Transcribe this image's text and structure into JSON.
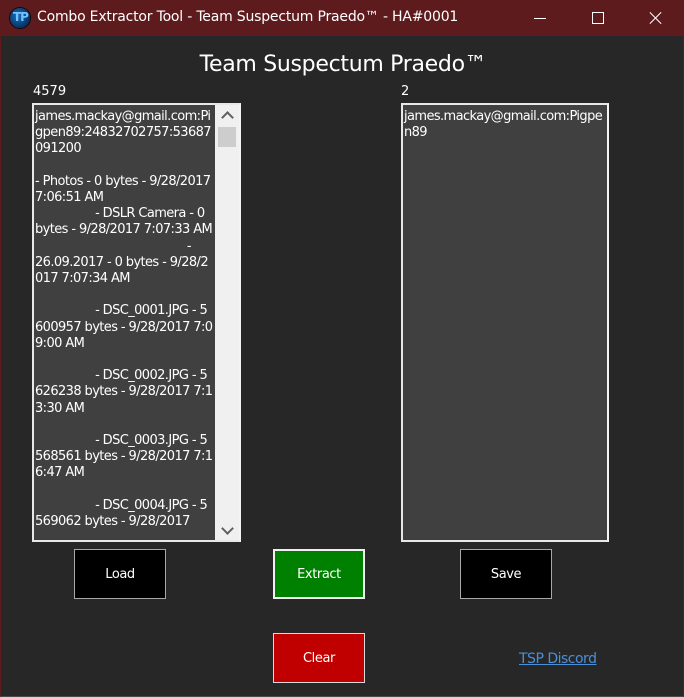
{
  "window": {
    "title": "Combo Extractor Tool - Team Suspectum Praedo™ - HA#0001",
    "icon": "tsp-logo-icon",
    "icon_glyph": "TP",
    "controls": {
      "minimize": "minimize-icon",
      "maximize": "maximize-icon",
      "close": "close-icon"
    },
    "colors": {
      "titlebar": "#5e1b1e",
      "background": "#272727"
    }
  },
  "heading": "Team Suspectum Praedo™",
  "input_panel": {
    "count": "4579",
    "content": "james.mackay@gmail.com:Pigpen89:24832702757:53687091200\n\n- Photos - 0 bytes - 9/28/2017 7:06:51 AM\n                 - DSLR Camera - 0 bytes - 9/28/2017 7:07:33 AM\n                                           -\n26.09.2017 - 0 bytes - 9/28/2017 7:07:34 AM\n\n                 - DSC_0001.JPG - 5600957 bytes - 9/28/2017 7:09:00 AM\n\n                 - DSC_0002.JPG - 5626238 bytes - 9/28/2017 7:13:30 AM\n\n                 - DSC_0003.JPG - 5568561 bytes - 9/28/2017 7:16:47 AM\n\n                 - DSC_0004.JPG - 5569062 bytes - 9/28/2017",
    "scrollbar": {
      "up_icon": "chevron-up-icon",
      "down_icon": "chevron-down-icon"
    }
  },
  "output_panel": {
    "count": "2",
    "content": "james.mackay@gmail.com:Pigpen89"
  },
  "buttons": {
    "load": "Load",
    "extract": "Extract",
    "save": "Save",
    "clear": "Clear"
  },
  "button_colors": {
    "load": "#000000",
    "extract": "#008000",
    "save": "#000000",
    "clear": "#c00000"
  },
  "link": {
    "label": "TSP Discord",
    "color": "#4a8fd8"
  }
}
